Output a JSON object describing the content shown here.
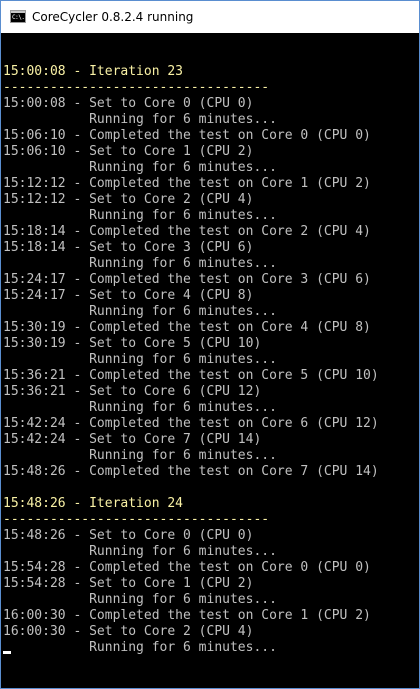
{
  "window": {
    "title": "CoreCycler 0.8.2.4 running",
    "icon_label": "C:\\."
  },
  "console": {
    "lines": [
      {
        "text": "",
        "color": "default"
      },
      {
        "text": "15:00:08 - Iteration 23",
        "color": "yellow"
      },
      {
        "text": "----------------------------------",
        "color": "yellow"
      },
      {
        "text": "15:00:08 - Set to Core 0 (CPU 0)",
        "color": "default"
      },
      {
        "text": "           Running for 6 minutes...",
        "color": "default"
      },
      {
        "text": "15:06:10 - Completed the test on Core 0 (CPU 0)",
        "color": "default"
      },
      {
        "text": "15:06:10 - Set to Core 1 (CPU 2)",
        "color": "default"
      },
      {
        "text": "           Running for 6 minutes...",
        "color": "default"
      },
      {
        "text": "15:12:12 - Completed the test on Core 1 (CPU 2)",
        "color": "default"
      },
      {
        "text": "15:12:12 - Set to Core 2 (CPU 4)",
        "color": "default"
      },
      {
        "text": "           Running for 6 minutes...",
        "color": "default"
      },
      {
        "text": "15:18:14 - Completed the test on Core 2 (CPU 4)",
        "color": "default"
      },
      {
        "text": "15:18:14 - Set to Core 3 (CPU 6)",
        "color": "default"
      },
      {
        "text": "           Running for 6 minutes...",
        "color": "default"
      },
      {
        "text": "15:24:17 - Completed the test on Core 3 (CPU 6)",
        "color": "default"
      },
      {
        "text": "15:24:17 - Set to Core 4 (CPU 8)",
        "color": "default"
      },
      {
        "text": "           Running for 6 minutes...",
        "color": "default"
      },
      {
        "text": "15:30:19 - Completed the test on Core 4 (CPU 8)",
        "color": "default"
      },
      {
        "text": "15:30:19 - Set to Core 5 (CPU 10)",
        "color": "default"
      },
      {
        "text": "           Running for 6 minutes...",
        "color": "default"
      },
      {
        "text": "15:36:21 - Completed the test on Core 5 (CPU 10)",
        "color": "default"
      },
      {
        "text": "15:36:21 - Set to Core 6 (CPU 12)",
        "color": "default"
      },
      {
        "text": "           Running for 6 minutes...",
        "color": "default"
      },
      {
        "text": "15:42:24 - Completed the test on Core 6 (CPU 12)",
        "color": "default"
      },
      {
        "text": "15:42:24 - Set to Core 7 (CPU 14)",
        "color": "default"
      },
      {
        "text": "           Running for 6 minutes...",
        "color": "default"
      },
      {
        "text": "15:48:26 - Completed the test on Core 7 (CPU 14)",
        "color": "default"
      },
      {
        "text": "",
        "color": "default"
      },
      {
        "text": "15:48:26 - Iteration 24",
        "color": "yellow"
      },
      {
        "text": "----------------------------------",
        "color": "yellow"
      },
      {
        "text": "15:48:26 - Set to Core 0 (CPU 0)",
        "color": "default"
      },
      {
        "text": "           Running for 6 minutes...",
        "color": "default"
      },
      {
        "text": "15:54:28 - Completed the test on Core 0 (CPU 0)",
        "color": "default"
      },
      {
        "text": "15:54:28 - Set to Core 1 (CPU 2)",
        "color": "default"
      },
      {
        "text": "           Running for 6 minutes...",
        "color": "default"
      },
      {
        "text": "16:00:30 - Completed the test on Core 1 (CPU 2)",
        "color": "default"
      },
      {
        "text": "16:00:30 - Set to Core 2 (CPU 4)",
        "color": "default"
      },
      {
        "text": "           Running for 6 minutes...",
        "color": "default"
      }
    ]
  },
  "colors": {
    "background": "#000000",
    "text": "#c0c0c0",
    "highlight": "#f9f1a5",
    "window_border": "#5a8ed0"
  }
}
